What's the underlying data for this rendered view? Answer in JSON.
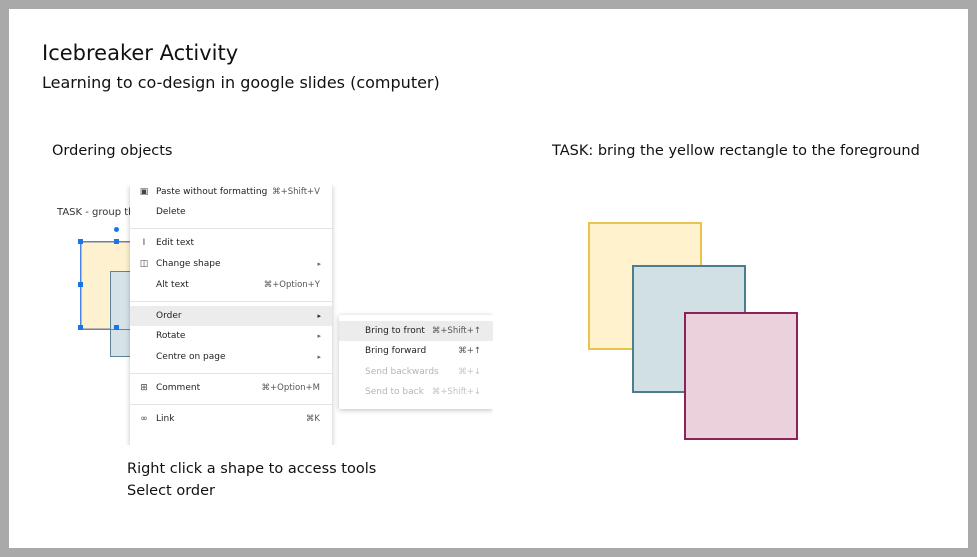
{
  "slide": {
    "title": "Icebreaker Activity",
    "subtitle": "Learning to co-design in google slides (computer)",
    "left_heading": "Ordering objects",
    "right_heading": "TASK: bring the yellow rectangle to the foreground",
    "instructions": [
      "Right click a shape to access tools",
      "Select order"
    ]
  },
  "screenshot": {
    "task_tag": "TASK - group th",
    "context_menu": {
      "items": [
        {
          "label": "Paste without formatting",
          "shortcut": "⌘+Shift+V",
          "icon": "paste-icon"
        },
        {
          "label": "Delete",
          "shortcut": "",
          "icon": ""
        },
        {
          "label": "Edit text",
          "shortcut": "",
          "icon": "edit-text-icon"
        },
        {
          "label": "Change shape",
          "shortcut": "▸",
          "icon": "change-shape-icon"
        },
        {
          "label": "Alt text",
          "shortcut": "⌘+Option+Y",
          "icon": ""
        },
        {
          "label": "Order",
          "shortcut": "▸",
          "icon": ""
        },
        {
          "label": "Rotate",
          "shortcut": "▸",
          "icon": ""
        },
        {
          "label": "Centre on page",
          "shortcut": "▸",
          "icon": ""
        },
        {
          "label": "Comment",
          "shortcut": "⌘+Option+M",
          "icon": "comment-icon"
        },
        {
          "label": "Link",
          "shortcut": "⌘K",
          "icon": "link-icon"
        }
      ]
    },
    "order_submenu": {
      "items": [
        {
          "label": "Bring to front",
          "shortcut": "⌘+Shift+↑",
          "enabled": true
        },
        {
          "label": "Bring forward",
          "shortcut": "⌘+↑",
          "enabled": true
        },
        {
          "label": "Send backwards",
          "shortcut": "⌘+↓",
          "enabled": false
        },
        {
          "label": "Send to back",
          "shortcut": "⌘+Shift+↓",
          "enabled": false
        }
      ]
    }
  },
  "diagram": {
    "colors": {
      "yellow_fill": "#fff2cc",
      "yellow_border": "#e8c34d",
      "blue_fill": "#d0e0e3",
      "blue_border": "#4d7c8f",
      "pink_fill": "#ead1dc",
      "pink_border": "#8a2358"
    }
  }
}
